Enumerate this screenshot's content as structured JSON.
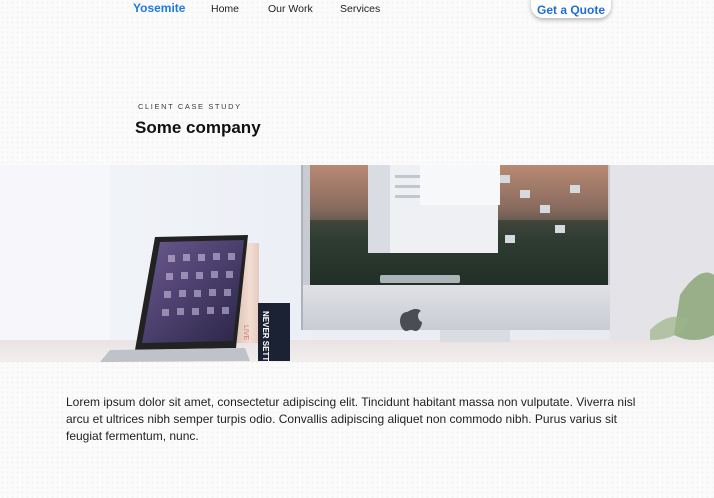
{
  "nav": {
    "brand": "Yosemite",
    "links": [
      "Home",
      "Our Work",
      "Services"
    ],
    "cta": "Get a Quote"
  },
  "case_study": {
    "eyebrow": "CLIENT CASE STUDY",
    "title": "Some company"
  },
  "hero_image": {
    "laptop_logo": "NEVER SETTLE"
  },
  "body": {
    "paragraph": "Lorem ipsum dolor sit amet, consectetur adipiscing elit. Tincidunt habitant massa non vulputate. Viverra nisl arcu et ultrices nibh semper turpis odio. Convallis adipiscing aliquet non commodo nibh. Purus varius sit feugiat fermentum, nunc."
  },
  "colors": {
    "brand": "#1f7ae0",
    "cta_text": "#1f6fd1"
  }
}
